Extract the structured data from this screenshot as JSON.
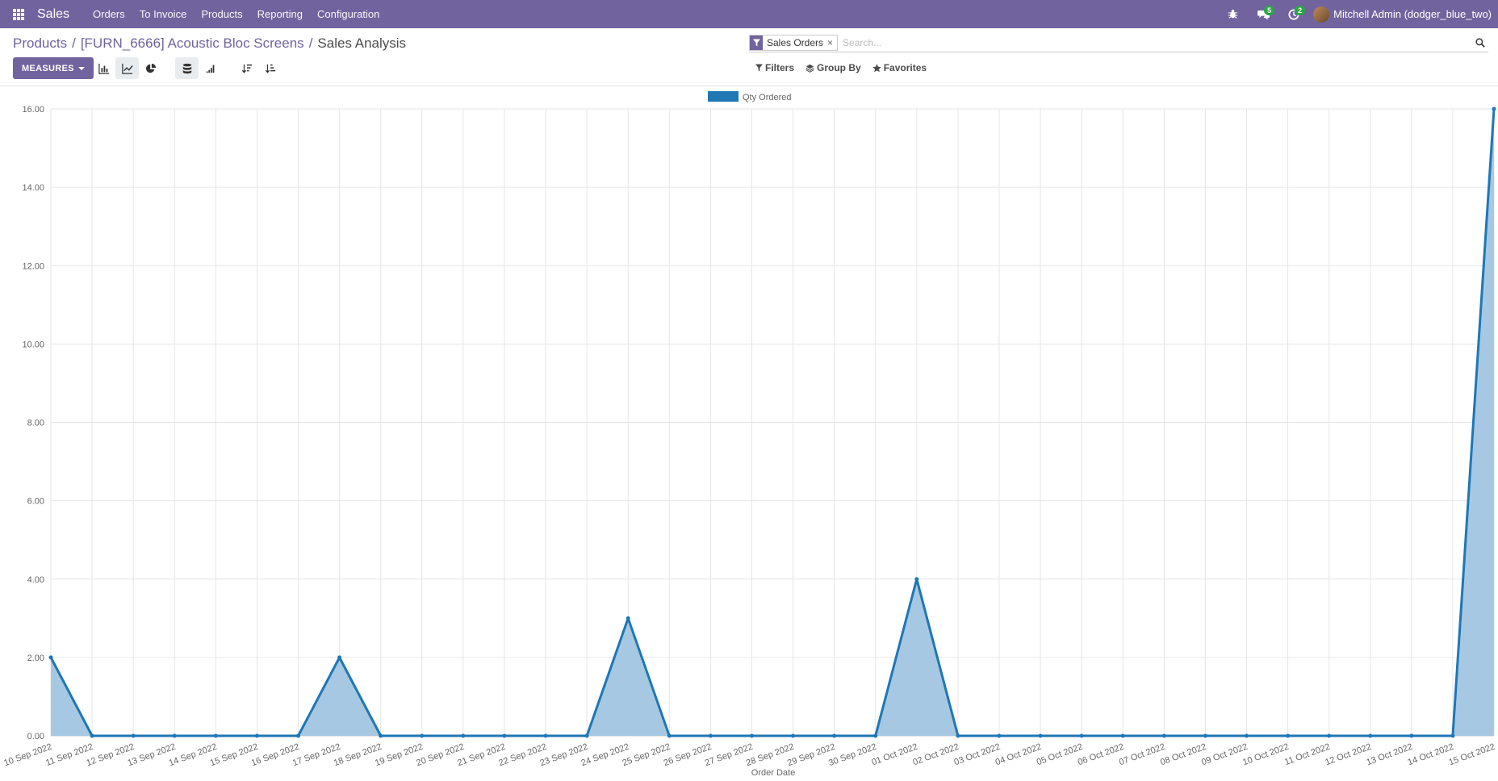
{
  "app": {
    "name": "Sales"
  },
  "menu": [
    "Orders",
    "To Invoice",
    "Products",
    "Reporting",
    "Configuration"
  ],
  "systray": {
    "messages_count": "5",
    "activities_count": "2",
    "user": "Mitchell Admin (dodger_blue_two)"
  },
  "breadcrumb": {
    "items": [
      "Products",
      "[FURN_6666] Acoustic Bloc Screens"
    ],
    "current": "Sales Analysis"
  },
  "toolbar": {
    "measures_label": "MEASURES"
  },
  "search": {
    "facet_label": "Sales Orders",
    "placeholder": "Search..."
  },
  "filters": {
    "filters_label": "Filters",
    "groupby_label": "Group By",
    "favorites_label": "Favorites"
  },
  "colors": {
    "brand": "#71639e",
    "series": "#1f77b4",
    "area": "#a6c8e2"
  },
  "chart_data": {
    "type": "area",
    "title": "",
    "xlabel": "Order Date",
    "ylabel": "",
    "ylim": [
      0,
      16
    ],
    "yticks": [
      "0.00",
      "2.00",
      "4.00",
      "6.00",
      "8.00",
      "10.00",
      "12.00",
      "14.00",
      "16.00"
    ],
    "legend": "top-center",
    "grid": true,
    "categories": [
      "10 Sep 2022",
      "11 Sep 2022",
      "12 Sep 2022",
      "13 Sep 2022",
      "14 Sep 2022",
      "15 Sep 2022",
      "16 Sep 2022",
      "17 Sep 2022",
      "18 Sep 2022",
      "19 Sep 2022",
      "20 Sep 2022",
      "21 Sep 2022",
      "22 Sep 2022",
      "23 Sep 2022",
      "24 Sep 2022",
      "25 Sep 2022",
      "26 Sep 2022",
      "27 Sep 2022",
      "28 Sep 2022",
      "29 Sep 2022",
      "30 Sep 2022",
      "01 Oct 2022",
      "02 Oct 2022",
      "03 Oct 2022",
      "04 Oct 2022",
      "05 Oct 2022",
      "06 Oct 2022",
      "07 Oct 2022",
      "08 Oct 2022",
      "09 Oct 2022",
      "10 Oct 2022",
      "11 Oct 2022",
      "12 Oct 2022",
      "13 Oct 2022",
      "14 Oct 2022",
      "15 Oct 2022"
    ],
    "series": [
      {
        "name": "Qty Ordered",
        "values": [
          2,
          0,
          0,
          0,
          0,
          0,
          0,
          2,
          0,
          0,
          0,
          0,
          0,
          0,
          3,
          0,
          0,
          0,
          0,
          0,
          0,
          4,
          0,
          0,
          0,
          0,
          0,
          0,
          0,
          0,
          0,
          0,
          0,
          0,
          0,
          16
        ]
      }
    ]
  }
}
